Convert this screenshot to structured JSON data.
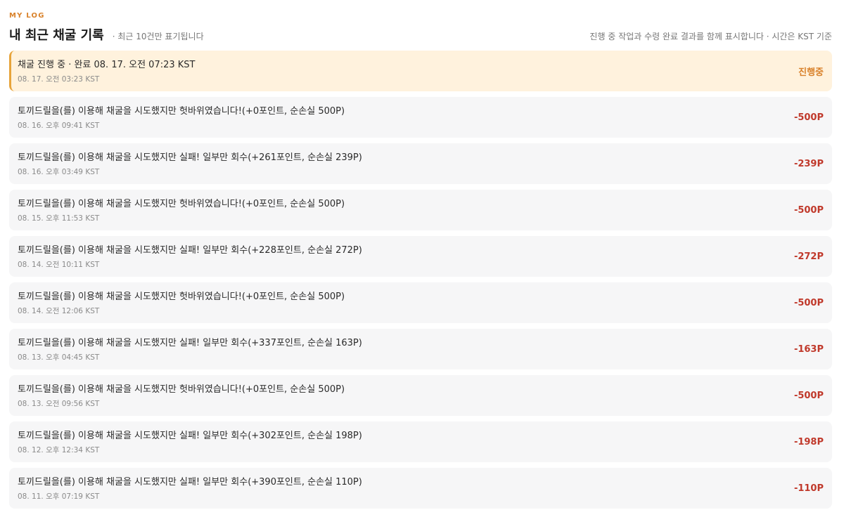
{
  "eyebrow": "MY LOG",
  "header": {
    "title": "내 최근 채굴 기록",
    "subtitle": "· 최근 10건만 표기됩니다",
    "note": "진행 중 작업과 수령 완료 결과를 함께 표시합니다 · 시간은 KST 기준"
  },
  "colors": {
    "accent": "#d9822b",
    "negative": "#c0392b",
    "active_bg": "#fff2dd",
    "row_bg": "#f6f6f7"
  },
  "rows": [
    {
      "text": "채굴 진행 중 · 완료 08. 17. 오전 07:23 KST",
      "time": "08. 17. 오전 03:23 KST",
      "value": "진행중",
      "status": "active"
    },
    {
      "text": "토끼드릴을(를) 이용해 채굴을 시도했지만 헛바위였습니다!(+0포인트, 순손실 500P)",
      "time": "08. 16. 오후 09:41 KST",
      "value": "-500P",
      "status": "loss"
    },
    {
      "text": "토끼드릴을(를) 이용해 채굴을 시도했지만 실패! 일부만 회수(+261포인트, 순손실 239P)",
      "time": "08. 16. 오후 03:49 KST",
      "value": "-239P",
      "status": "loss"
    },
    {
      "text": "토끼드릴을(를) 이용해 채굴을 시도했지만 헛바위였습니다!(+0포인트, 순손실 500P)",
      "time": "08. 15. 오후 11:53 KST",
      "value": "-500P",
      "status": "loss"
    },
    {
      "text": "토끼드릴을(를) 이용해 채굴을 시도했지만 실패! 일부만 회수(+228포인트, 순손실 272P)",
      "time": "08. 14. 오전 10:11 KST",
      "value": "-272P",
      "status": "loss"
    },
    {
      "text": "토끼드릴을(를) 이용해 채굴을 시도했지만 헛바위였습니다!(+0포인트, 순손실 500P)",
      "time": "08. 14. 오전 12:06 KST",
      "value": "-500P",
      "status": "loss"
    },
    {
      "text": "토끼드릴을(를) 이용해 채굴을 시도했지만 실패! 일부만 회수(+337포인트, 순손실 163P)",
      "time": "08. 13. 오후 04:45 KST",
      "value": "-163P",
      "status": "loss"
    },
    {
      "text": "토끼드릴을(를) 이용해 채굴을 시도했지만 헛바위였습니다!(+0포인트, 순손실 500P)",
      "time": "08. 13. 오전 09:56 KST",
      "value": "-500P",
      "status": "loss"
    },
    {
      "text": "토끼드릴을(를) 이용해 채굴을 시도했지만 실패! 일부만 회수(+302포인트, 순손실 198P)",
      "time": "08. 12. 오후 12:34 KST",
      "value": "-198P",
      "status": "loss"
    },
    {
      "text": "토끼드릴을(를) 이용해 채굴을 시도했지만 실패! 일부만 회수(+390포인트, 순손실 110P)",
      "time": "08. 11. 오후 07:19 KST",
      "value": "-110P",
      "status": "loss"
    }
  ]
}
